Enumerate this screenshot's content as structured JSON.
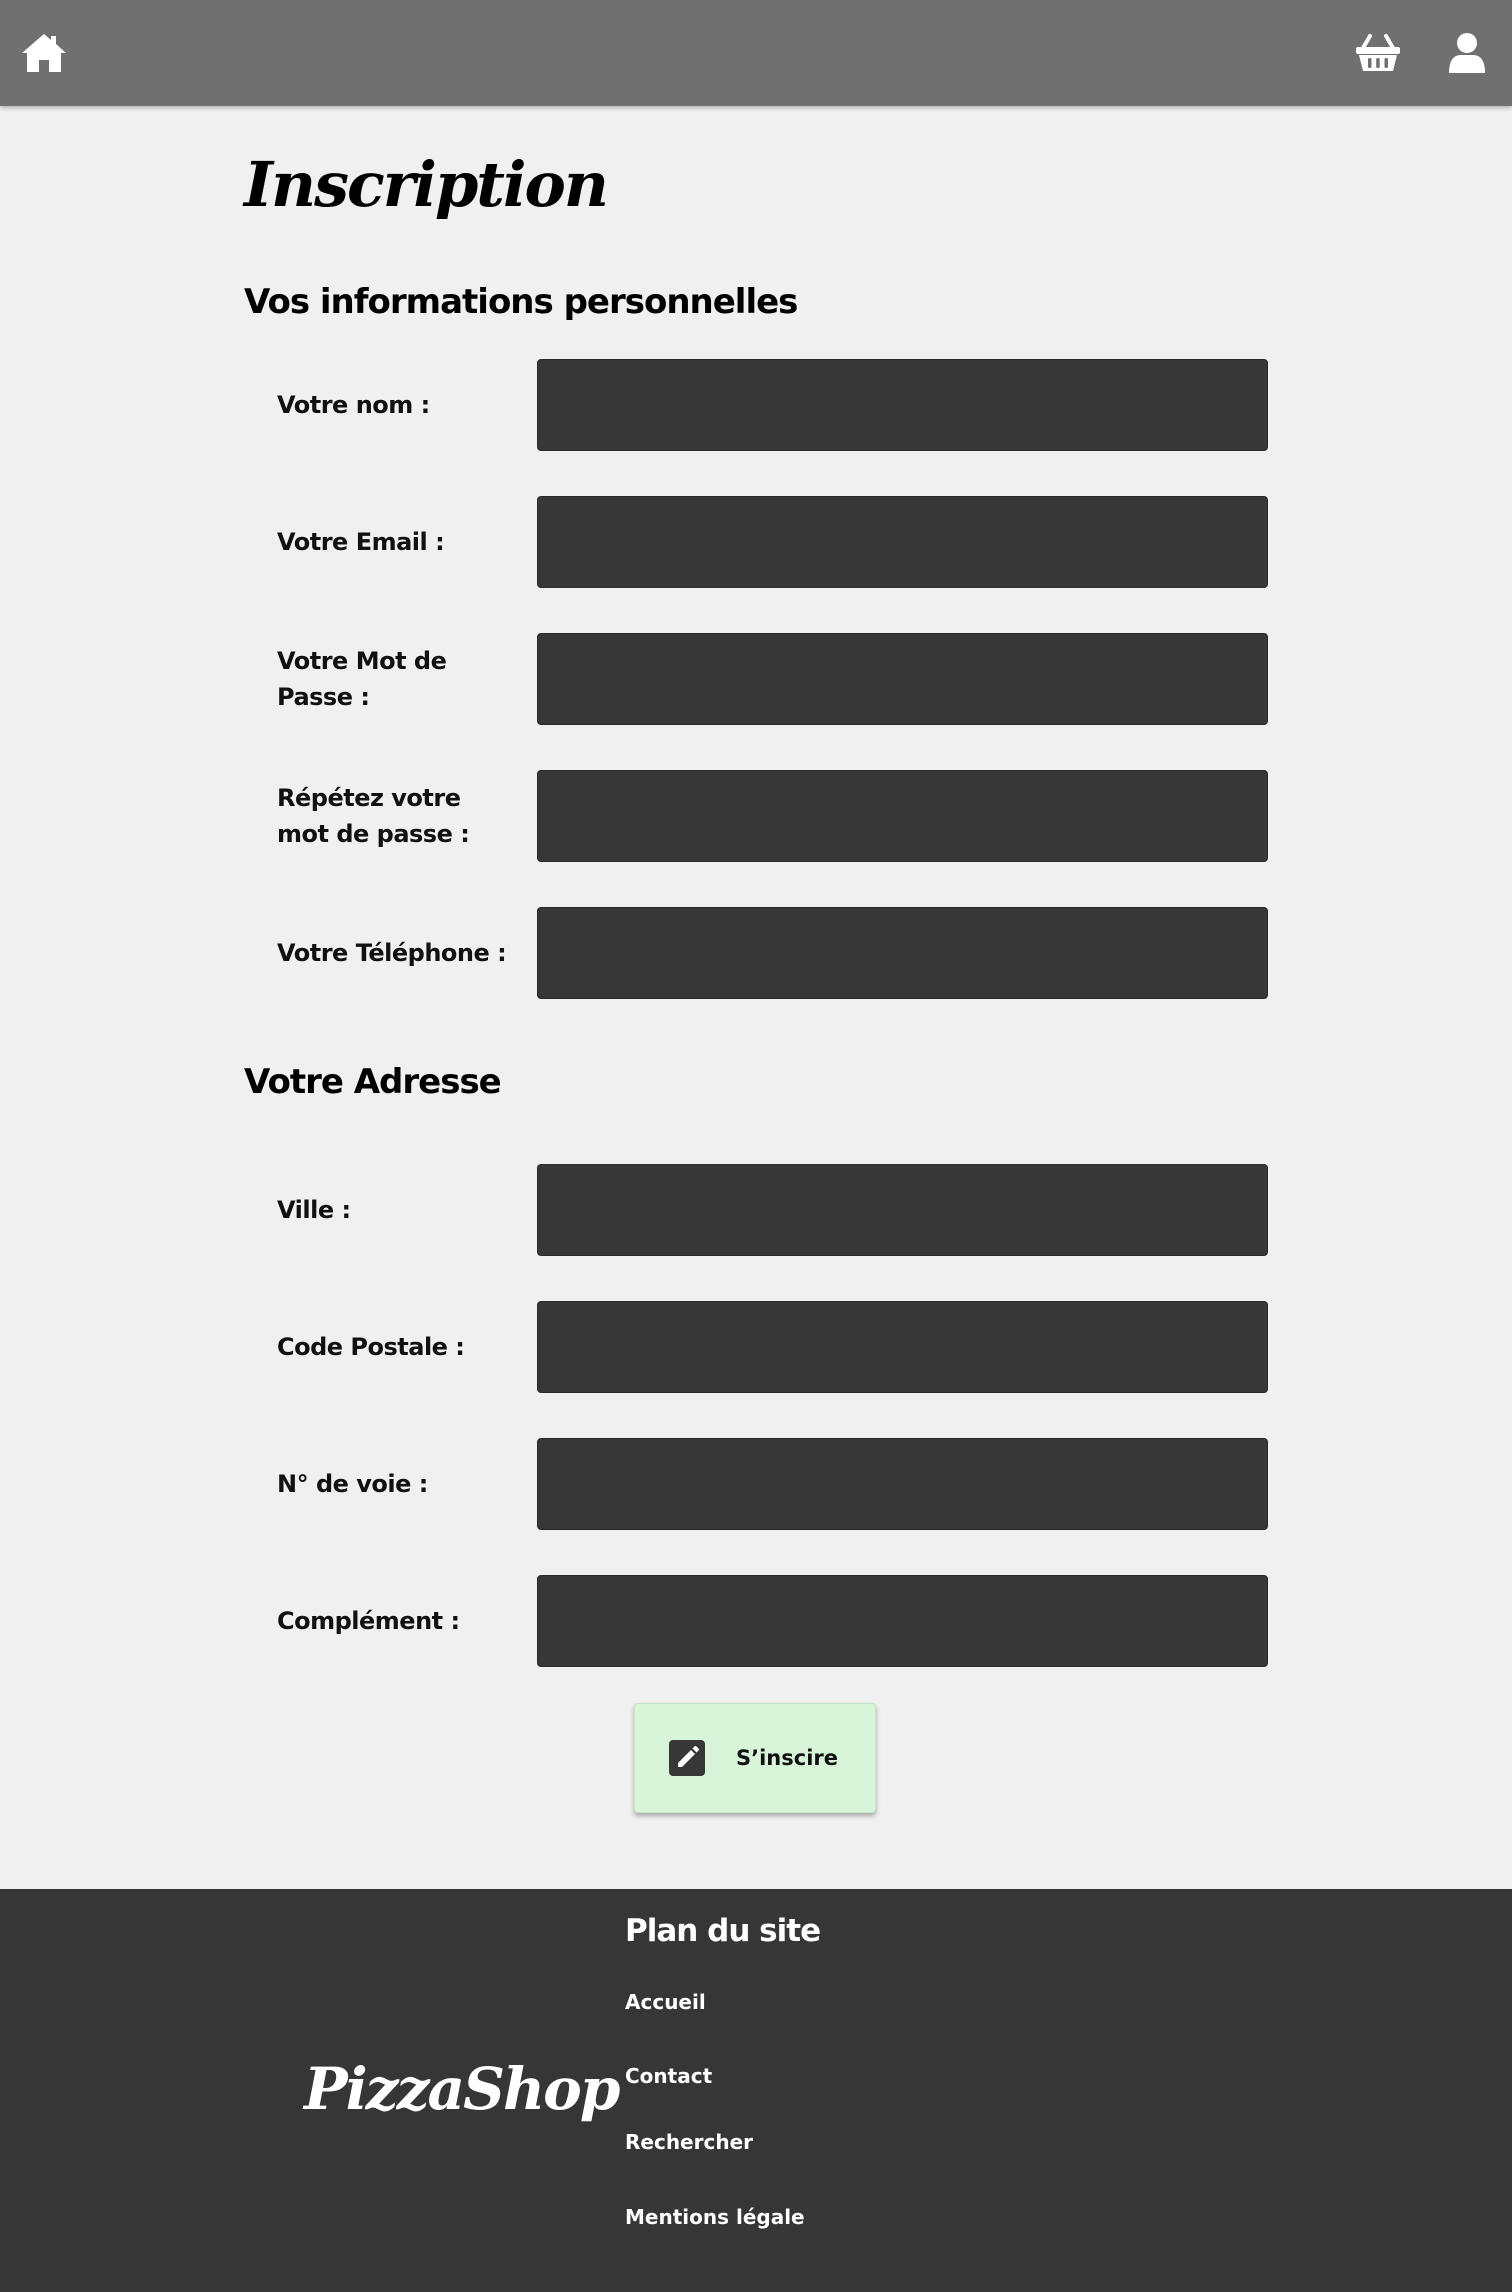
{
  "header": {
    "icons": [
      "home-icon",
      "basket-icon",
      "user-icon"
    ],
    "background": "#707070"
  },
  "main": {
    "title": "Inscription",
    "personal_section": {
      "title": "Vos informations personnelles",
      "fields": [
        {
          "label": "Votre nom :",
          "value": "",
          "placeholder": ""
        },
        {
          "label": "Votre Email :",
          "value": "",
          "placeholder": ""
        },
        {
          "label": "Votre Mot de Passe :",
          "value": "",
          "placeholder": ""
        },
        {
          "label": "Répétez votre mot de passe :",
          "value": "",
          "placeholder": ""
        },
        {
          "label": "Votre Téléphone :",
          "value": "",
          "placeholder": ""
        }
      ]
    },
    "address_section": {
      "title": "Votre Adresse",
      "fields": [
        {
          "label": "Ville :",
          "value": "",
          "placeholder": ""
        },
        {
          "label": "Code Postale :",
          "value": "",
          "placeholder": ""
        },
        {
          "label": "N° de voie :",
          "value": "",
          "placeholder": ""
        },
        {
          "label": "Complément :",
          "value": "",
          "placeholder": ""
        }
      ]
    },
    "submit": {
      "label": "S’inscire",
      "icon": "edit-icon"
    }
  },
  "footer": {
    "logo": "PizzaShop",
    "sitemap_title": "Plan du site",
    "links": [
      "Accueil",
      "Contact",
      "Rechercher",
      "Mentions légale"
    ]
  },
  "colors": {
    "page_background": "#f0f0f0",
    "input_background": "#373737",
    "button_background": "#d8f5d9",
    "footer_background": "#363636"
  }
}
